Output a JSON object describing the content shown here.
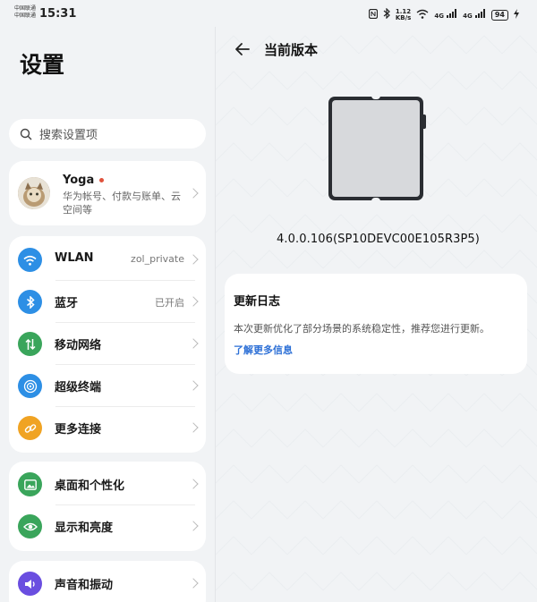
{
  "status_bar": {
    "carrier_1": "中国联通",
    "carrier_2": "中国联通",
    "time": "15:31",
    "speed_value": "1.12",
    "speed_unit": "KB/s",
    "network_1": "4G",
    "network_2": "4G",
    "battery": "94"
  },
  "settings": {
    "title": "设置",
    "search_placeholder": "搜索设置项",
    "account": {
      "name": "Yoga",
      "subtitle": "华为帐号、付款与账单、云空间等"
    },
    "network_items": [
      {
        "label": "WLAN",
        "value": "zol_private",
        "icon": "wifi-icon",
        "color": "#2d8fe5"
      },
      {
        "label": "蓝牙",
        "value": "已开启",
        "icon": "bluetooth-icon",
        "color": "#2d8fe5"
      },
      {
        "label": "移动网络",
        "value": "",
        "icon": "mobile-data-icon",
        "color": "#3aa55b"
      },
      {
        "label": "超级终端",
        "value": "",
        "icon": "super-device-icon",
        "color": "#2d8fe5"
      },
      {
        "label": "更多连接",
        "value": "",
        "icon": "link-icon",
        "color": "#f0a323"
      }
    ],
    "display_items": [
      {
        "label": "桌面和个性化",
        "icon": "wallpaper-icon",
        "color": "#3aa55b"
      },
      {
        "label": "显示和亮度",
        "icon": "eye-icon",
        "color": "#3aa55b"
      }
    ],
    "sound_items": [
      {
        "label": "声音和振动",
        "icon": "speaker-icon",
        "color": "#6a4ee0"
      }
    ]
  },
  "version_page": {
    "title": "当前版本",
    "version": "4.0.0.106(SP10DEVC00E105R3P5)",
    "changelog_title": "更新日志",
    "changelog_body": "本次更新优化了部分场景的系统稳定性，推荐您进行更新。",
    "learn_more": "了解更多信息"
  }
}
